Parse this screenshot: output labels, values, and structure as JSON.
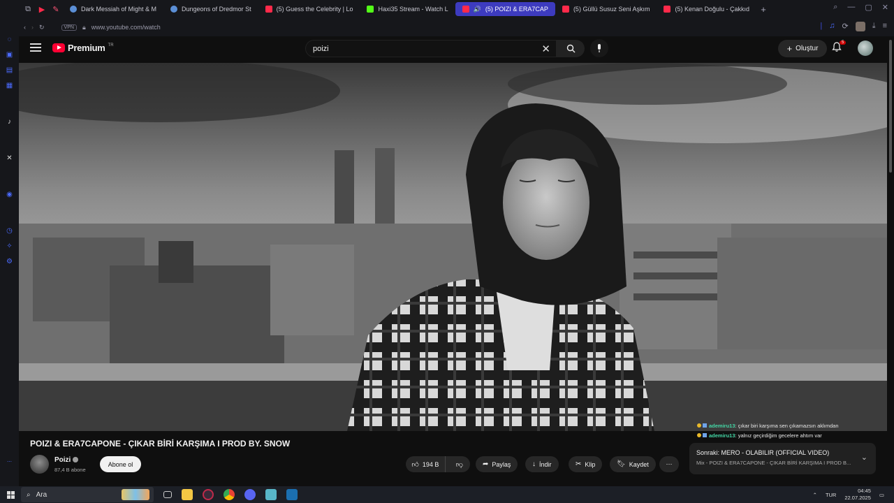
{
  "browser": {
    "tabs": [
      {
        "label": "Dark Messiah of Might & M",
        "color": "#5b8fd6"
      },
      {
        "label": "Dungeons of Dredmor St",
        "color": "#5b8fd6"
      },
      {
        "label": "(5) Guess the Celebrity | Lo",
        "color": "#ff2a4a"
      },
      {
        "label": "Haxi35 Stream - Watch L",
        "color": "#53fc18"
      },
      {
        "label": "(5) POIZI & ERA7CAP",
        "color": "#ff2a4a"
      },
      {
        "label": "(5) Güllü Susuz Seni Aşkım",
        "color": "#ff2a4a"
      },
      {
        "label": "(5) Kenan Doğulu - Çakkıd",
        "color": "#ff2a4a"
      }
    ],
    "new_tab": "+",
    "vpn_label": "VPN",
    "url": "www.youtube.com/watch"
  },
  "youtube": {
    "logo_text": "Premium",
    "logo_region": "TR",
    "search_value": "poizi",
    "create_label": "Oluştur",
    "notification_count": "5"
  },
  "video": {
    "title": "POIZI & ERA7CAPONE - ÇIKAR BİRİ KARŞIMA I PROD BY. SNOW",
    "channel_name": "Poizi",
    "subscribers": "87,4 B abone",
    "subscribe_label": "Abone ol",
    "likes": "194 B",
    "share_label": "Paylaş",
    "download_label": "İndir",
    "clip_label": "Klip",
    "save_label": "Kaydet",
    "more_label": "⋯"
  },
  "chat": [
    {
      "user": "ademiru13",
      "message": ": çıkar biri karşıma sen çıkamazsın aklımdan"
    },
    {
      "user": "ademiru13",
      "message": ": yalnız geçirdiğim gecelere ahtım var"
    }
  ],
  "up_next": {
    "title": "Sonraki: MERO - OLABILIR (OFFICIAL VIDEO)",
    "subtitle": "Mix - POIZI & ERA7CAPONE - ÇIKAR BİRİ KARŞIMA I PROD B..."
  },
  "taskbar": {
    "search_placeholder": "Ara",
    "language": "TUR",
    "time": "04:45",
    "date": "22.07.2025"
  }
}
